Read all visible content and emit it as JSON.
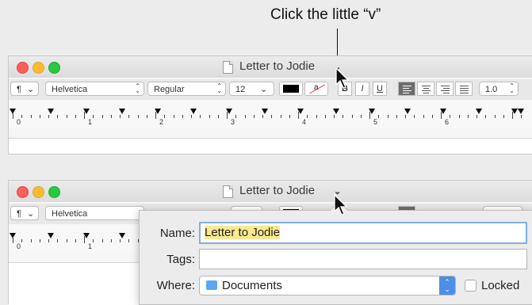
{
  "callout": {
    "text": "Click the little “v”"
  },
  "window": {
    "title": "Letter to Jodie",
    "chevron": "⌄"
  },
  "toolbar": {
    "paragraph_label": "¶",
    "font_family": "Helvetica",
    "font_style": "Regular",
    "font_size": "12",
    "text_color": "#000000",
    "bold_label": "B",
    "italic_label": "I",
    "underline_label": "U",
    "line_spacing": "1.0",
    "highlight_label": "a"
  },
  "ruler": {
    "numbers": [
      "0",
      "1",
      "2",
      "3",
      "4",
      "5",
      "6"
    ]
  },
  "popover": {
    "name_label": "Name:",
    "name_value": "Letter to Jodie",
    "tags_label": "Tags:",
    "tags_value": "",
    "where_label": "Where:",
    "where_value": "Documents",
    "locked_label": "Locked"
  },
  "colors": {
    "accent": "#4b8fe9",
    "name_highlight": "#fbe990"
  },
  "icons": [
    "document-icon",
    "chevron-down-icon",
    "mouse-pointer-icon",
    "folder-icon"
  ]
}
